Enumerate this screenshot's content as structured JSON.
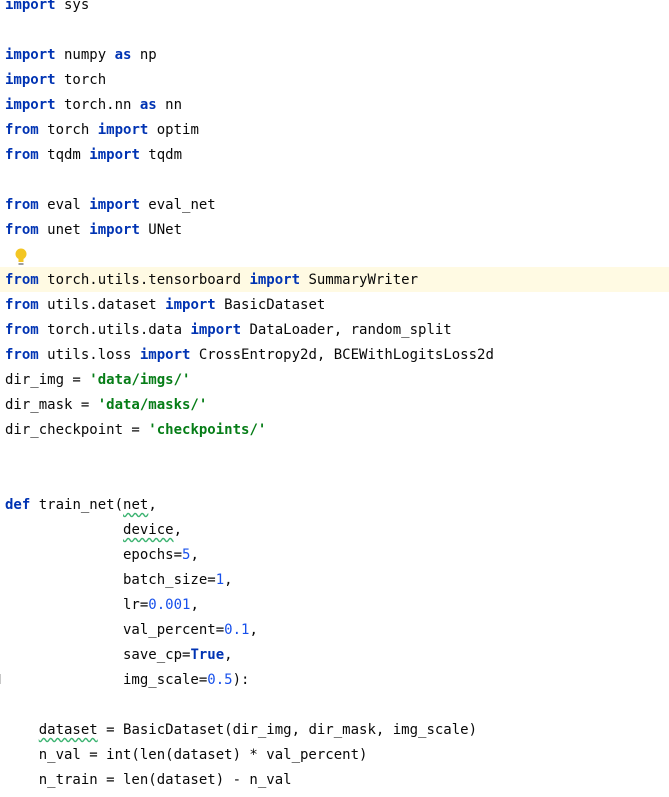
{
  "editor": {
    "colors": {
      "keyword": "#0033b3",
      "string": "#067d17",
      "number": "#1750eb",
      "current_line": "#fffae3",
      "bulb": "#f3c623"
    },
    "icons": [
      "intention-bulb-icon"
    ],
    "lines": [
      [
        {
          "t": "import",
          "s": "kw"
        },
        {
          "t": " sys"
        }
      ],
      [],
      [
        {
          "t": "import",
          "s": "kw"
        },
        {
          "t": " numpy "
        },
        {
          "t": "as",
          "s": "kw"
        },
        {
          "t": " np"
        }
      ],
      [
        {
          "t": "import",
          "s": "kw"
        },
        {
          "t": " torch"
        }
      ],
      [
        {
          "t": "import",
          "s": "kw"
        },
        {
          "t": " torch.nn "
        },
        {
          "t": "as",
          "s": "kw"
        },
        {
          "t": " nn"
        }
      ],
      [
        {
          "t": "from",
          "s": "kw"
        },
        {
          "t": " torch "
        },
        {
          "t": "import",
          "s": "kw"
        },
        {
          "t": " optim"
        }
      ],
      [
        {
          "t": "from",
          "s": "kw"
        },
        {
          "t": " tqdm "
        },
        {
          "t": "import",
          "s": "kw"
        },
        {
          "t": " tqdm"
        }
      ],
      [],
      [
        {
          "t": "from",
          "s": "kw"
        },
        {
          "t": " eval "
        },
        {
          "t": "import",
          "s": "kw"
        },
        {
          "t": " eval_net"
        }
      ],
      [
        {
          "t": "from",
          "s": "kw"
        },
        {
          "t": " unet "
        },
        {
          "t": "import",
          "s": "kw"
        },
        {
          "t": " UNet"
        }
      ],
      [],
      [
        {
          "t": "from",
          "s": "kw"
        },
        {
          "t": " torch.utils.tensorboard "
        },
        {
          "t": "import",
          "s": "kw"
        },
        {
          "t": " SummaryWriter"
        }
      ],
      [
        {
          "t": "from",
          "s": "kw"
        },
        {
          "t": " utils.dataset "
        },
        {
          "t": "import",
          "s": "kw"
        },
        {
          "t": " BasicDataset"
        }
      ],
      [
        {
          "t": "from",
          "s": "kw"
        },
        {
          "t": " torch.utils.data "
        },
        {
          "t": "import",
          "s": "kw"
        },
        {
          "t": " DataLoader, random_split"
        }
      ],
      [
        {
          "t": "from",
          "s": "kw"
        },
        {
          "t": " utils.loss "
        },
        {
          "t": "import",
          "s": "kw"
        },
        {
          "t": " CrossEntropy2d, BCEWithLogitsLoss2d"
        }
      ],
      [
        {
          "t": "dir_img = "
        },
        {
          "t": "'data/imgs/'",
          "s": "str"
        }
      ],
      [
        {
          "t": "dir_mask = "
        },
        {
          "t": "'data/masks/'",
          "s": "str"
        }
      ],
      [
        {
          "t": "dir_checkpoint = "
        },
        {
          "t": "'checkpoints/'",
          "s": "str"
        }
      ],
      [],
      [],
      [
        {
          "t": "def",
          "s": "kw"
        },
        {
          "t": " train_net("
        },
        {
          "t": "net",
          "s": "typo"
        },
        {
          "t": ","
        }
      ],
      [
        {
          "t": "              "
        },
        {
          "t": "device",
          "s": "typo"
        },
        {
          "t": ","
        }
      ],
      [
        {
          "t": "              epochs="
        },
        {
          "t": "5",
          "s": "num"
        },
        {
          "t": ","
        }
      ],
      [
        {
          "t": "              batch_size="
        },
        {
          "t": "1",
          "s": "num"
        },
        {
          "t": ","
        }
      ],
      [
        {
          "t": "              lr="
        },
        {
          "t": "0.001",
          "s": "num"
        },
        {
          "t": ","
        }
      ],
      [
        {
          "t": "              val_percent="
        },
        {
          "t": "0.1",
          "s": "num"
        },
        {
          "t": ","
        }
      ],
      [
        {
          "t": "              save_cp="
        },
        {
          "t": "True",
          "s": "kw"
        },
        {
          "t": ","
        }
      ],
      [
        {
          "t": "              img_scale="
        },
        {
          "t": "0.5",
          "s": "num"
        },
        {
          "t": "):"
        }
      ],
      [],
      [
        {
          "t": "    "
        },
        {
          "t": "dataset",
          "s": "typo"
        },
        {
          "t": " = BasicDataset(dir_img, dir_mask, img_scale)"
        }
      ],
      [
        {
          "t": "    n_val = int(len(dataset) * val_percent)"
        }
      ],
      [
        {
          "t": "    n_train = len(dataset) - n_val"
        }
      ]
    ]
  }
}
